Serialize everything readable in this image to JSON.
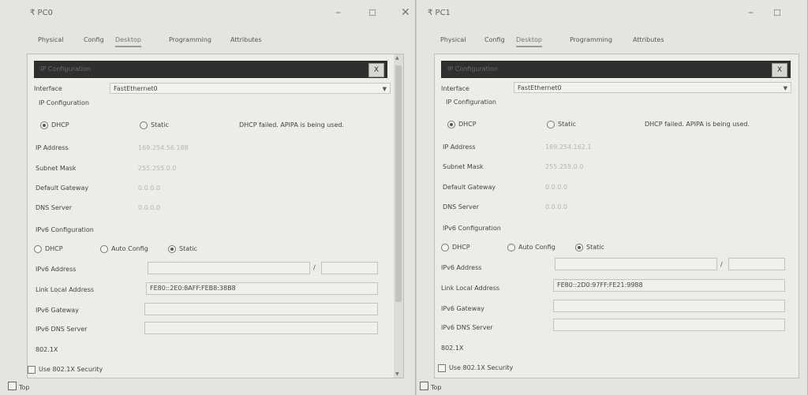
{
  "pc0": {
    "title": "PC0",
    "tabs": [
      "Physical",
      "Config",
      "Desktop",
      "Programming",
      "Attributes"
    ],
    "header_title": "IP Configuration",
    "close_label": "X",
    "interface_label": "Interface",
    "interface_value": "FastEthernet0",
    "ip_config_label": "IP Configuration",
    "dhcp_label": "DHCP",
    "static_label": "Static",
    "dhcp_status": "DHCP failed. APIPA is being used.",
    "ip_address_label": "IP Address",
    "ip_address_value": "169.254.56.188",
    "subnet_label": "Subnet Mask",
    "subnet_value": "255.255.0.0",
    "gateway_label": "Default Gateway",
    "gateway_value": "0.0.0.0",
    "dns_label": "DNS Server",
    "dns_value": "0.0.0.0",
    "ipv6_config_label": "IPv6 Configuration",
    "ipv6_dhcp_label": "DHCP",
    "ipv6_auto_label": "Auto Config",
    "ipv6_static_label": "Static",
    "ipv6_addr_label": "IPv6 Address",
    "ipv6_addr_value": "",
    "ipv6_prefix_sep": "/",
    "ipv6_prefix_value": "",
    "link_local_label": "Link Local Address",
    "link_local_value": "FE80::2E0:8AFF:FEB8:38B8",
    "ipv6_gw_label": "IPv6 Gateway",
    "ipv6_gw_value": "",
    "ipv6_dns_label": "IPv6 DNS Server",
    "ipv6_dns_value": "",
    "dot1x_label": "802.1X",
    "use_dot1x_label": "Use 802.1X Security",
    "top_label": "Top"
  },
  "pc1": {
    "title": "PC1",
    "tabs": [
      "Physical",
      "Config",
      "Desktop",
      "Programming",
      "Attributes"
    ],
    "header_title": "IP Configuration",
    "close_label": "X",
    "interface_label": "Interface",
    "interface_value": "FastEthernet0",
    "ip_config_label": "IP Configuration",
    "dhcp_label": "DHCP",
    "static_label": "Static",
    "dhcp_status": "DHCP failed. APIPA is being used.",
    "ip_address_label": "IP Address",
    "ip_address_value": "169.254.162.1",
    "subnet_label": "Subnet Mask",
    "subnet_value": "255.255.0.0",
    "gateway_label": "Default Gateway",
    "gateway_value": "0.0.0.0",
    "dns_label": "DNS Server",
    "dns_value": "0.0.0.0",
    "ipv6_config_label": "IPv6 Configuration",
    "ipv6_dhcp_label": "DHCP",
    "ipv6_auto_label": "Auto Config",
    "ipv6_static_label": "Static",
    "ipv6_addr_label": "IPv6 Address",
    "ipv6_addr_value": "",
    "ipv6_prefix_sep": "/",
    "ipv6_prefix_value": "",
    "link_local_label": "Link Local Address",
    "link_local_value": "FE80::2D0:97FF:FE21:9988",
    "ipv6_gw_label": "IPv6 Gateway",
    "ipv6_gw_value": "",
    "ipv6_dns_label": "IPv6 DNS Server",
    "ipv6_dns_value": "",
    "dot1x_label": "802.1X",
    "use_dot1x_label": "Use 802.1X Security",
    "top_label": "Top"
  },
  "window_controls": {
    "minimize": "–",
    "maximize": "☐",
    "close": "✕"
  },
  "icons": {
    "window": "packet-tracer-pc-icon",
    "dropdown": "chevron-down-icon"
  }
}
